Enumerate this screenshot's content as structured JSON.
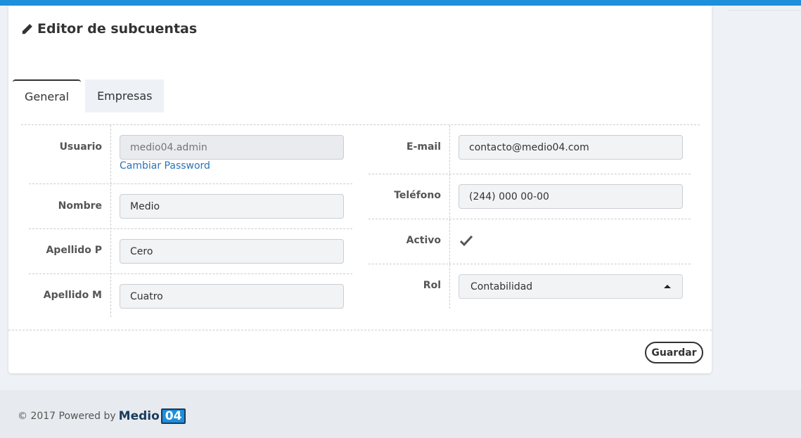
{
  "page": {
    "title": "Editor de subcuentas",
    "icon": "pencil-icon"
  },
  "tabs": [
    {
      "label": "General",
      "active": true
    },
    {
      "label": "Empresas",
      "active": false
    }
  ],
  "form": {
    "usuario": {
      "label": "Usuario",
      "placeholder": "medio04.admin",
      "disabled": true
    },
    "change_password": "Cambiar Password",
    "nombre": {
      "label": "Nombre",
      "value": "Medio"
    },
    "apellido_p": {
      "label": "Apellido P",
      "value": "Cero"
    },
    "apellido_m": {
      "label": "Apellido M",
      "value": "Cuatro"
    },
    "email": {
      "label": "E-mail",
      "value": "contacto@medio04.com"
    },
    "telefono": {
      "label": "Teléfono",
      "value": "(244) 000 00-00"
    },
    "activo": {
      "label": "Activo",
      "checked": true
    },
    "rol": {
      "label": "Rol",
      "value": "Contabilidad"
    }
  },
  "actions": {
    "save_label": "Guardar"
  },
  "footer": {
    "copyright": "© 2017 Powered by",
    "logo_text": "Medio",
    "logo_number": "04"
  },
  "colors": {
    "accent": "#1e8fdb",
    "link": "#2a73b8",
    "logo_dark": "#1a3b5d"
  }
}
